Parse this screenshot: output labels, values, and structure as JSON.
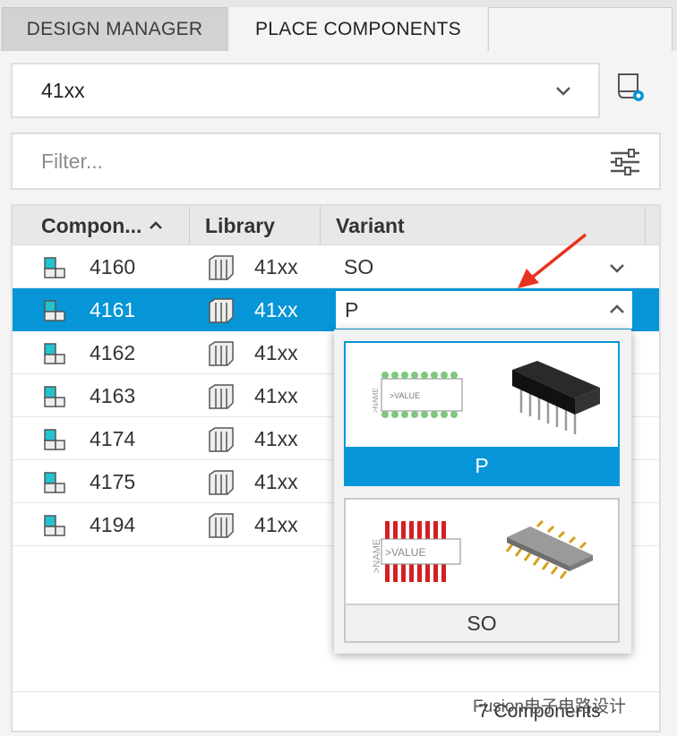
{
  "tabs": [
    {
      "label": "DESIGN MANAGER",
      "active": false
    },
    {
      "label": "PLACE COMPONENTS",
      "active": true
    }
  ],
  "library_select": {
    "value": "41xx",
    "icon": "chevron-down-icon"
  },
  "filter": {
    "placeholder": "Filter..."
  },
  "table": {
    "columns": [
      "Compon...",
      "Library",
      "Variant"
    ],
    "rows": [
      {
        "component": "4160",
        "library": "41xx",
        "variant": "SO"
      },
      {
        "component": "4161",
        "library": "41xx",
        "variant": "P",
        "selected": true
      },
      {
        "component": "4162",
        "library": "41xx"
      },
      {
        "component": "4163",
        "library": "41xx"
      },
      {
        "component": "4174",
        "library": "41xx"
      },
      {
        "component": "4175",
        "library": "41xx"
      },
      {
        "component": "4194",
        "library": "41xx"
      }
    ]
  },
  "variant_dropdown": {
    "options": [
      {
        "label": "P",
        "selected": true,
        "symbol_name": ">NAME",
        "symbol_value": ">VALUE"
      },
      {
        "label": "SO",
        "selected": false,
        "symbol_name": ">NAME",
        "symbol_value": ">VALUE"
      }
    ]
  },
  "footer": {
    "count_text": "7 Components"
  },
  "watermark": "Fusion电子电路设计",
  "colors": {
    "accent": "#0696d7",
    "arrow": "#e8321e"
  }
}
